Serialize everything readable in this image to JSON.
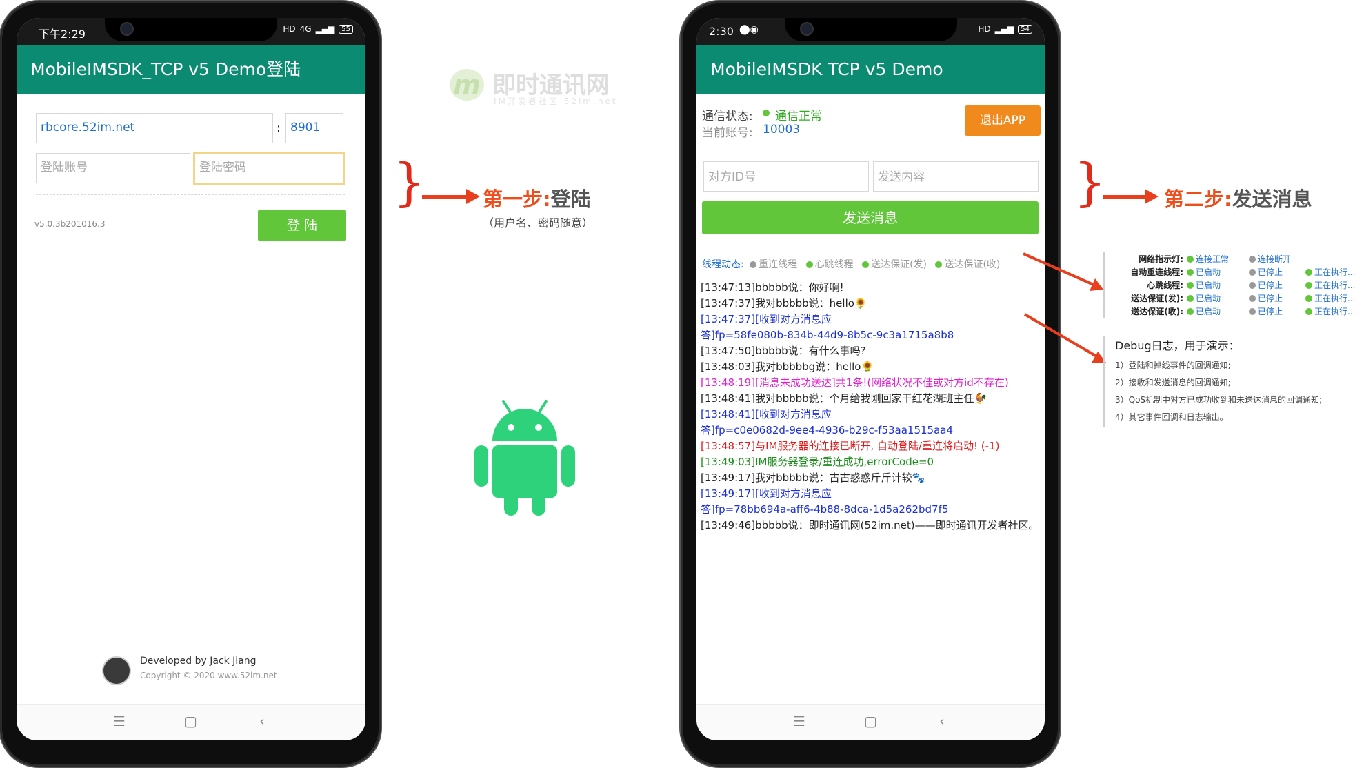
{
  "left_phone": {
    "status_time": "下午2:29",
    "signal": "4G",
    "battery": "55",
    "appbar_title": "MobileIMSDK_TCP v5 Demo登陆",
    "server_host": "rbcore.52im.net",
    "separator": ":",
    "server_port": "8901",
    "account_placeholder": "登陆账号",
    "password_placeholder": "登陆密码",
    "version": "v5.0.3b201016.3",
    "login_button": "登 陆",
    "developer": "Developed by Jack Jiang",
    "copyright": "Copyright © 2020 www.52im.net"
  },
  "watermark": {
    "name": "即时通讯网",
    "sub": "IM开发者社区 52im.net"
  },
  "right_phone": {
    "status_time": "2:30",
    "battery": "54",
    "appbar_title": "MobileIMSDK TCP v5 Demo",
    "conn_label": "通信状态:",
    "conn_value": "通信正常",
    "account_label": "当前账号:",
    "account_value": "10003",
    "exit_button": "退出APP",
    "peer_placeholder": "对方ID号",
    "content_placeholder": "发送内容",
    "send_button": "发送消息",
    "threads_label": "线程动态:",
    "threads": [
      "重连线程",
      "心跳线程",
      "送达保证(发)",
      "送达保证(收)"
    ],
    "log": [
      {
        "text": "[13:47:13]bbbbb说：你好啊!",
        "color": "#222222"
      },
      {
        "text": "[13:47:37]我对bbbbb说：hello🌻",
        "color": "#222222"
      },
      {
        "text": "[13:47:37][收到对方消息应",
        "color": "#1a2fd8"
      },
      {
        "text": "答]fp=58fe080b-834b-44d9-8b5c-9c3a1715a8b8",
        "color": "#1a2fd8"
      },
      {
        "text": "[13:47:50]bbbbb说：有什么事吗?",
        "color": "#222222"
      },
      {
        "text": "[13:48:03]我对bbbbbg说：hello🌻",
        "color": "#222222"
      },
      {
        "text": "[13:48:19][消息未成功送达]共1条!(网络状况不佳或对方id不存在)",
        "color": "#e020d0"
      },
      {
        "text": "[13:48:41]我对bbbbb说：个月给我刚回家干红花湖班主任🐓",
        "color": "#222222"
      },
      {
        "text": "[13:48:41][收到对方消息应",
        "color": "#1a2fd8"
      },
      {
        "text": "答]fp=c0e0682d-9ee4-4936-b29c-f53aa1515aa4",
        "color": "#1a2fd8"
      },
      {
        "text": "[13:48:57]与IM服务器的连接已断开, 自动登陆/重连将启动! (-1)",
        "color": "#e01b1b"
      },
      {
        "text": "[13:49:03]IM服务器登录/重连成功,errorCode=0",
        "color": "#1d8f1d"
      },
      {
        "text": "[13:49:17]我对bbbbb说：古古惑惑斤斤计较🐾",
        "color": "#222222"
      },
      {
        "text": "[13:49:17][收到对方消息应",
        "color": "#1a2fd8"
      },
      {
        "text": "答]fp=78bb694a-aff6-4b88-8dca-1d5a262bd7f5",
        "color": "#1a2fd8"
      },
      {
        "text": "[13:49:46]bbbbb说：即时通讯网(52im.net)——即时通讯开发者社区。",
        "color": "#222222"
      }
    ]
  },
  "step1": {
    "prefix": "第一步:",
    "title": "登陆",
    "note": "（用户名、密码随意）"
  },
  "step2": {
    "prefix": "第二步:",
    "title": "发送消息"
  },
  "indicator_panel": {
    "rows": [
      {
        "label": "网络指示灯:",
        "c1": "连接正常",
        "c2": "连接断开",
        "c3": ""
      },
      {
        "label": "自动重连线程:",
        "c1": "已启动",
        "c2": "已停止",
        "c3": "正在执行..."
      },
      {
        "label": "心跳线程:",
        "c1": "已启动",
        "c2": "已停止",
        "c3": "正在执行..."
      },
      {
        "label": "送达保证(发):",
        "c1": "已启动",
        "c2": "已停止",
        "c3": "正在执行..."
      },
      {
        "label": "送达保证(收):",
        "c1": "已启动",
        "c2": "已停止",
        "c3": "正在执行..."
      }
    ]
  },
  "debug_panel": {
    "title": "Debug日志，用于演示：",
    "items": [
      "1）登陆和掉线事件的回调通知;",
      "2）接收和发送消息的回调通知;",
      "3）QoS机制中对方已成功收到和未送达消息的回调通知;",
      "4）其它事件回调和日志输出。"
    ]
  },
  "colors": {
    "appbar": "#0c8b73",
    "green_button": "#62c63a",
    "orange_button": "#f08a1c",
    "arrow": "#e8401e"
  }
}
